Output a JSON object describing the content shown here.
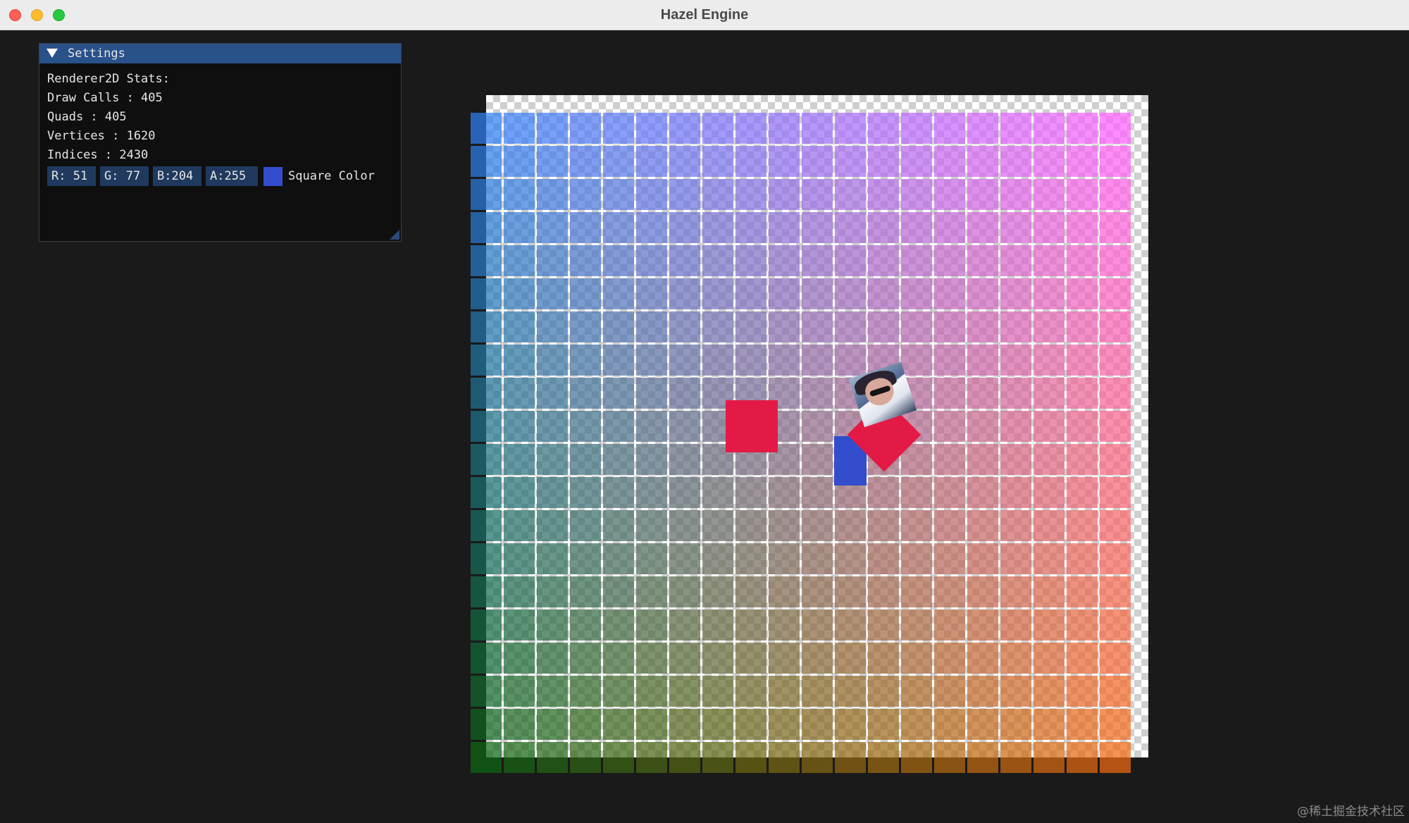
{
  "window": {
    "title": "Hazel Engine"
  },
  "settings_panel": {
    "title": "Settings",
    "stats_heading": "Renderer2D Stats:",
    "draw_calls": "Draw Calls : 405",
    "quads": "Quads : 405",
    "vertices": "Vertices : 1620",
    "indices": "Indices : 2430",
    "color_fields": {
      "r": "R: 51",
      "g": "G: 77",
      "b": "B:204",
      "a": "A:255"
    },
    "square_color_label": "Square Color",
    "square_color": "#334dcc"
  },
  "scene": {
    "checkerboard_background": true,
    "grid_rows": 20,
    "grid_cols": 20,
    "grid_color_top_left": "#2f7ff5",
    "grid_color_top_right": "#ff60ff",
    "grid_color_bottom_left": "#0c6614",
    "grid_color_bottom_right": "#f06a10",
    "red_quad_color": "#e31a45",
    "blue_quad_color": "#334dcc"
  },
  "watermark": "@稀土掘金技术社区"
}
